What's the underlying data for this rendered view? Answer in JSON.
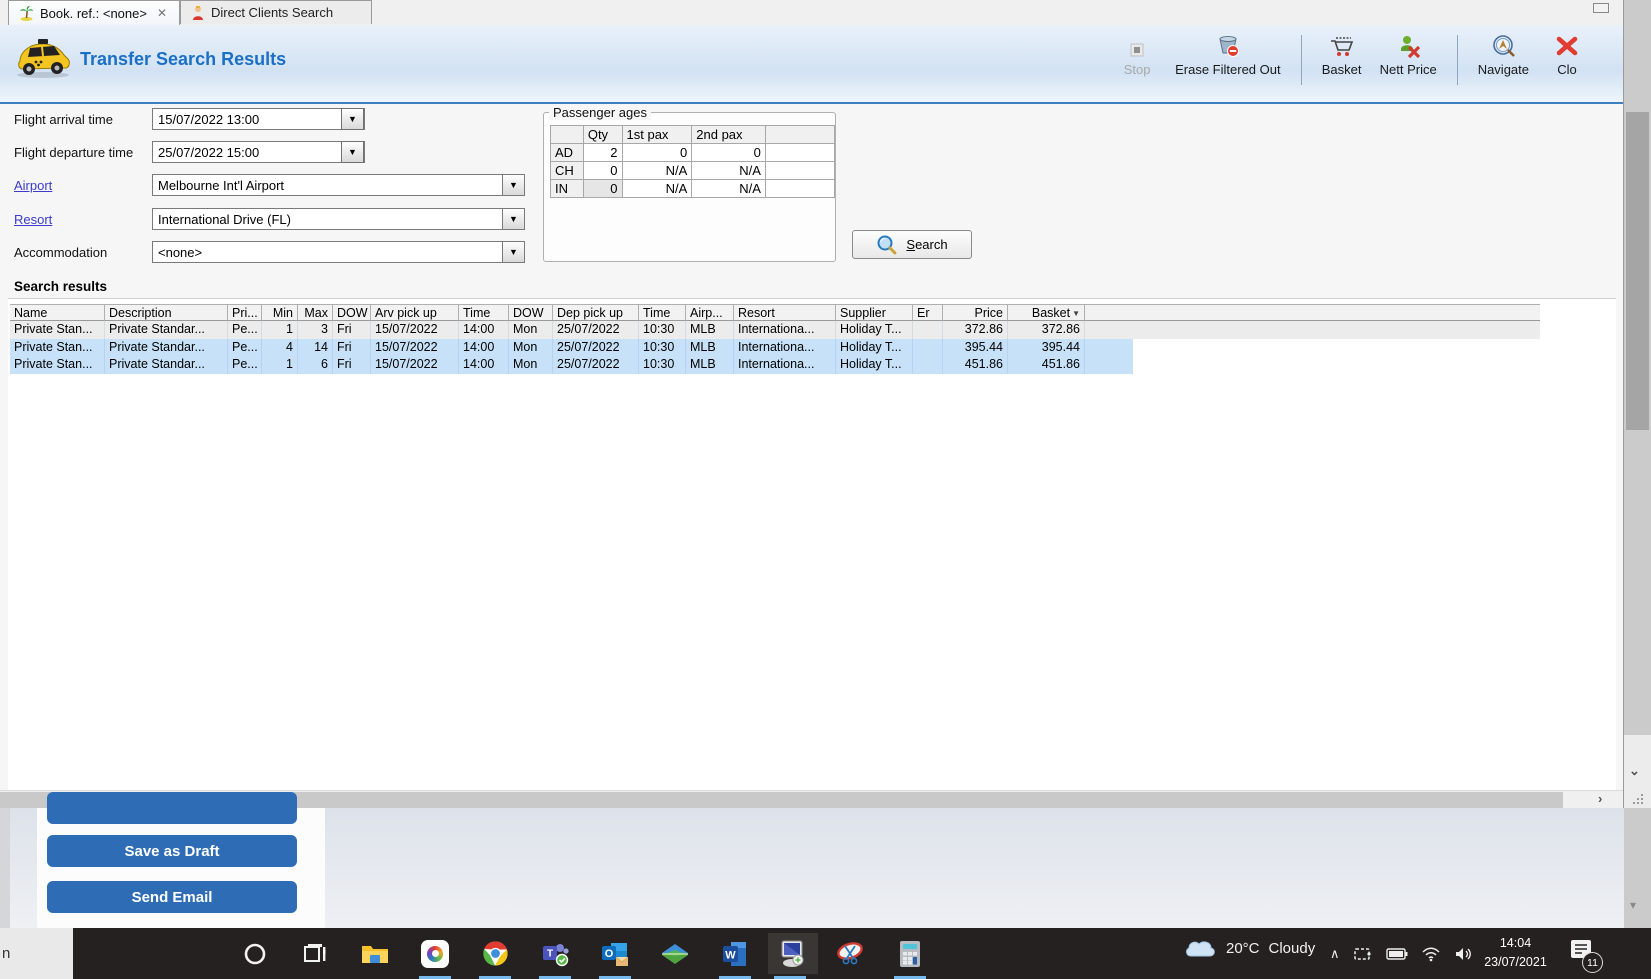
{
  "tabs": [
    {
      "label": "Book. ref.: <none>",
      "close_glyph": "✕",
      "icon": "palm-tree-icon"
    },
    {
      "label": "Direct Clients Search",
      "icon": "person-icon"
    }
  ],
  "window": {
    "minimize_glyph": ""
  },
  "header": {
    "title": "Transfer Search Results",
    "title_icon": "taxi-icon",
    "toolbar": [
      {
        "label": "Stop",
        "icon": "stop-icon",
        "disabled": true
      },
      {
        "label": "Erase Filtered Out",
        "icon": "erase-bucket-icon"
      },
      {
        "label": "Basket",
        "icon": "basket-cart-icon"
      },
      {
        "label": "Nett Price",
        "icon": "nett-price-icon"
      },
      {
        "label": "Navigate",
        "icon": "compass-icon"
      },
      {
        "label": "Clo",
        "icon": "close-x-icon"
      }
    ]
  },
  "form": {
    "fields": [
      {
        "label": "Flight arrival time",
        "value": "15/07/2022 13:00",
        "link": false
      },
      {
        "label": "Flight departure time",
        "value": "25/07/2022 15:00",
        "link": false
      },
      {
        "label": "Airport",
        "value": "Melbourne Int'l Airport",
        "link": true
      },
      {
        "label": "Resort",
        "value": "International Drive (FL)",
        "link": true
      },
      {
        "label": "Accommodation",
        "value": "<none>",
        "link": false
      }
    ]
  },
  "passenger_ages": {
    "title": "Passenger ages",
    "columns": [
      "",
      "Qty",
      "1st pax",
      "2nd pax",
      ""
    ],
    "rows": [
      [
        "AD",
        "2",
        "0",
        "0"
      ],
      [
        "CH",
        "0",
        "N/A",
        "N/A"
      ],
      [
        "IN",
        "0",
        "N/A",
        "N/A"
      ]
    ]
  },
  "search_button": {
    "label_pre": "S",
    "label_rest": "earch",
    "icon": "search-magnifier-icon"
  },
  "results": {
    "title": "Search results",
    "columns": [
      "Name",
      "Description",
      "Pri...",
      "Min",
      "Max",
      "DOW",
      "Arv pick up",
      "Time",
      "DOW",
      "Dep pick up",
      "Time",
      "Airp...",
      "Resort",
      "Supplier",
      "Er",
      "Price",
      "Basket"
    ],
    "sorted_column": "Basket",
    "sort_glyph": "▼",
    "row_styles": [
      "focused",
      "selected",
      "selected"
    ],
    "rows": [
      [
        "Private Stan...",
        "Private Standar...",
        "Pe...",
        "1",
        "3",
        "Fri",
        "15/07/2022",
        "14:00",
        "Mon",
        "25/07/2022",
        "10:30",
        "MLB",
        "Internationa...",
        "Holiday T...",
        "",
        "372.86",
        "372.86"
      ],
      [
        "Private Stan...",
        "Private Standar...",
        "Pe...",
        "4",
        "14",
        "Fri",
        "15/07/2022",
        "14:00",
        "Mon",
        "25/07/2022",
        "10:30",
        "MLB",
        "Internationa...",
        "Holiday T...",
        "",
        "395.44",
        "395.44"
      ],
      [
        "Private Stan...",
        "Private Standar...",
        "Pe...",
        "1",
        "6",
        "Fri",
        "15/07/2022",
        "14:00",
        "Mon",
        "25/07/2022",
        "10:30",
        "MLB",
        "Internationa...",
        "Holiday T...",
        "",
        "451.86",
        "451.86"
      ]
    ]
  },
  "scrollbars": {
    "h_arrow": "›",
    "v_chevron": "⌄",
    "v_down": "▾"
  },
  "webpage": {
    "buttons": [
      "Save as Draft",
      "Send Email"
    ],
    "search_remnant": "n"
  },
  "taskbar": {
    "icons": [
      "cortana-icon",
      "task-view-icon",
      "file-explorer-icon",
      "app-tile-icon",
      "chrome-icon",
      "teams-icon",
      "outlook-icon",
      "layers-diamond-icon",
      "word-icon",
      "remote-desktop-icon",
      "snipping-tool-icon",
      "calculator-icon"
    ],
    "weather": {
      "temp": "20°C",
      "condition": "Cloudy"
    },
    "tray_chevron": "∧",
    "clock": {
      "time": "14:04",
      "date": "23/07/2021"
    },
    "notification_count": "11"
  },
  "colors": {
    "title_blue": "#1a6fc7",
    "link_blue": "#3b3bcc",
    "selected_row": "#c7e2f8",
    "focused_row": "#ececec",
    "web_button_blue": "#2e6db6",
    "taskbar_dark": "#252120",
    "header_band": "#d2e2f3"
  }
}
